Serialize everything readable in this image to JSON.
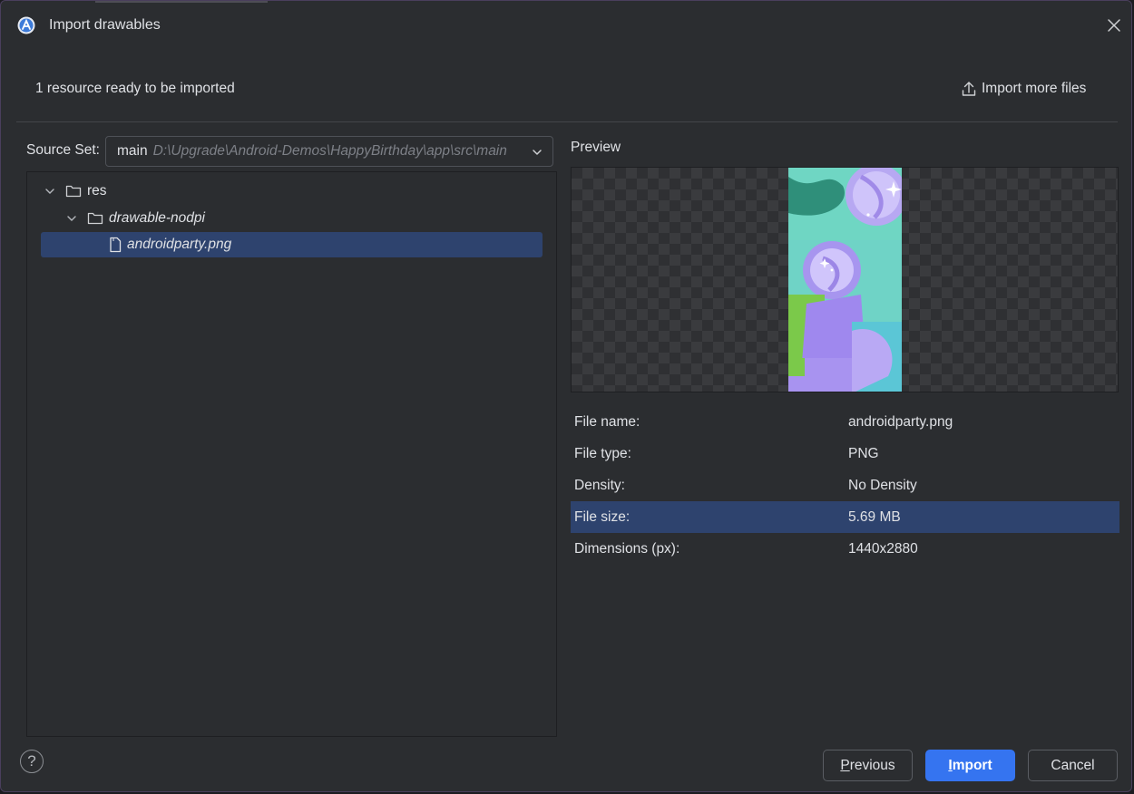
{
  "window": {
    "title": "Import drawables",
    "close_icon": "close-icon",
    "logo_icon": "android-studio-logo-icon"
  },
  "header": {
    "status": "1 resource ready to be imported",
    "import_more_label": "Import more files",
    "import_more_icon": "upload-icon"
  },
  "source_set": {
    "label": "Source Set:",
    "value": "main",
    "path": "D:\\Upgrade\\Android-Demos\\HappyBirthday\\app\\src\\main"
  },
  "tree": {
    "items": [
      {
        "label": "res",
        "icon": "folder-icon",
        "expanded": true
      },
      {
        "label": "drawable-nodpi",
        "icon": "folder-icon",
        "expanded": true
      },
      {
        "label": "androidparty.png",
        "icon": "file-icon",
        "selected": true
      }
    ]
  },
  "preview": {
    "label": "Preview"
  },
  "properties": [
    {
      "key": "File name:",
      "value": "androidparty.png"
    },
    {
      "key": "File type:",
      "value": "PNG"
    },
    {
      "key": "Density:",
      "value": "No Density"
    },
    {
      "key": "File size:",
      "value": "5.69 MB",
      "selected": true
    },
    {
      "key": "Dimensions (px):",
      "value": "1440x2880"
    }
  ],
  "footer": {
    "help": "?",
    "previous_first": "P",
    "previous_rest": "revious",
    "import_first": "I",
    "import_rest": "mport",
    "cancel": "Cancel"
  },
  "colors": {
    "accent": "#3574f0",
    "selection": "#2e436e",
    "background": "#2b2d30"
  }
}
